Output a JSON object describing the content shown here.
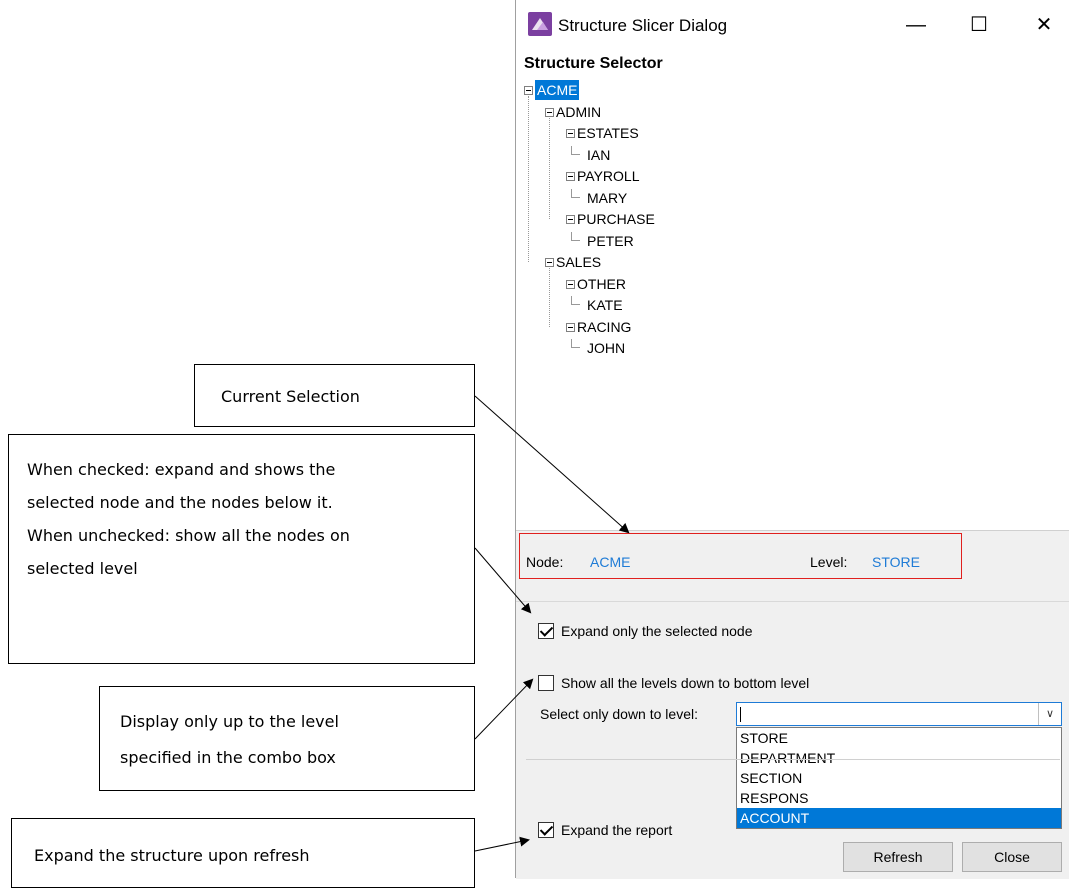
{
  "dialog": {
    "title": "Structure Slicer Dialog",
    "minimize_glyph": "—",
    "maximize_glyph": "☐",
    "close_glyph": "✕",
    "app_icon": "structure-slicer-app-icon",
    "accent_color": "#0078d7",
    "link_color": "#1e7bd6"
  },
  "tree": {
    "header": "Structure Selector",
    "nodes": [
      {
        "label": "ACME",
        "depth": 0,
        "selected": true
      },
      {
        "label": "ADMIN",
        "depth": 1
      },
      {
        "label": "ESTATES",
        "depth": 2
      },
      {
        "label": "IAN",
        "depth": 3
      },
      {
        "label": "PAYROLL",
        "depth": 2
      },
      {
        "label": "MARY",
        "depth": 3
      },
      {
        "label": "PURCHASE",
        "depth": 2
      },
      {
        "label": "PETER",
        "depth": 3
      },
      {
        "label": "SALES",
        "depth": 1
      },
      {
        "label": "OTHER",
        "depth": 2
      },
      {
        "label": "KATE",
        "depth": 3
      },
      {
        "label": "RACING",
        "depth": 2
      },
      {
        "label": "JOHN",
        "depth": 3
      }
    ]
  },
  "info": {
    "node_label": "Node:",
    "node_value": "ACME",
    "level_label": "Level:",
    "level_value": "STORE"
  },
  "options": {
    "expand_selected": {
      "label": "Expand only the selected node",
      "checked": true
    },
    "show_all_levels": {
      "label": "Show all the levels down to bottom level",
      "checked": false
    },
    "level_combo_label": "Select only down to level:",
    "level_combo_value": "",
    "level_options": [
      "STORE",
      "DEPARTMENT",
      "SECTION",
      "RESPONS",
      "ACCOUNT"
    ],
    "highlighted_option": "ACCOUNT",
    "expand_report": {
      "label": "Expand the report",
      "checked": true
    }
  },
  "buttons": {
    "refresh": "Refresh",
    "close": "Close"
  },
  "callouts": {
    "current_selection": "Current Selection",
    "expand_note": [
      "When checked: expand and shows the",
      "selected node and the nodes below it.",
      "When unchecked: show all the nodes on",
      "selected level"
    ],
    "level_note": [
      "Display only up to the level",
      "specified in the combo box"
    ],
    "refresh_note": "Expand the structure upon refresh"
  }
}
